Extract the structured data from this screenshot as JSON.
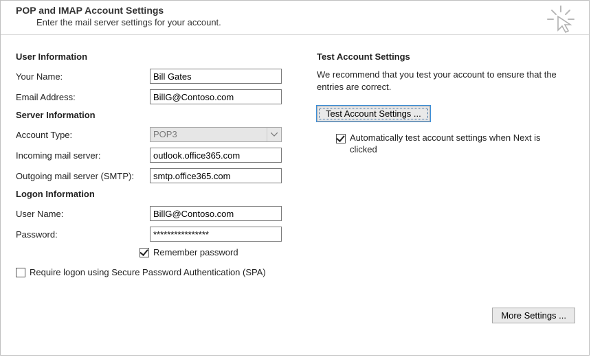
{
  "header": {
    "title": "POP and IMAP Account Settings",
    "subtitle": "Enter the mail server settings for your account."
  },
  "left": {
    "userInfo": {
      "heading": "User Information",
      "yourNameLabel": "Your Name:",
      "yourNameValue": "Bill Gates",
      "emailLabel": "Email Address:",
      "emailValue": "BillG@Contoso.com"
    },
    "serverInfo": {
      "heading": "Server Information",
      "accountTypeLabel": "Account Type:",
      "accountTypeValue": "POP3",
      "incomingLabel": "Incoming mail server:",
      "incomingValue": "outlook.office365.com",
      "outgoingLabel": "Outgoing mail server (SMTP):",
      "outgoingValue": "smtp.office365.com"
    },
    "logon": {
      "heading": "Logon Information",
      "userNameLabel": "User Name:",
      "userNameValue": "BillG@Contoso.com",
      "passwordLabel": "Password:",
      "passwordValue": "****************",
      "rememberPassword": "Remember password",
      "spaLabel": "Require logon using Secure Password Authentication (SPA)"
    }
  },
  "right": {
    "heading": "Test Account Settings",
    "paragraph": "We recommend that you test your account to ensure that the entries are correct.",
    "testButton": "Test Account Settings ...",
    "autoTest": "Automatically test account settings when Next is clicked",
    "moreSettings": "More Settings ..."
  }
}
